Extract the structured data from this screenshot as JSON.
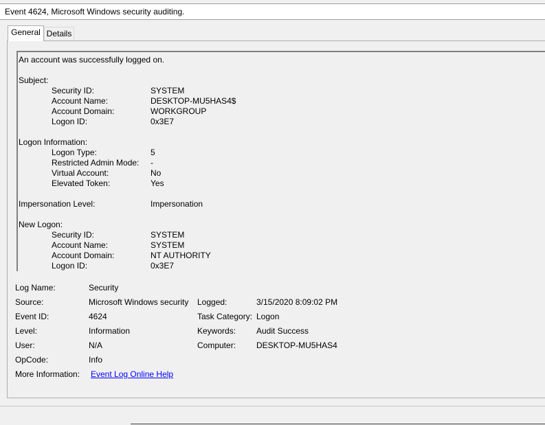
{
  "window": {
    "title": "Event 4624, Microsoft Windows security auditing."
  },
  "tabs": [
    {
      "label": "General"
    },
    {
      "label": "Details"
    }
  ],
  "description": {
    "summary": "An account was successfully logged on.",
    "subject": {
      "heading": "Subject:",
      "rows": [
        {
          "label": "Security ID:",
          "value": "SYSTEM"
        },
        {
          "label": "Account Name:",
          "value": "DESKTOP-MU5HAS4$"
        },
        {
          "label": "Account Domain:",
          "value": "WORKGROUP"
        },
        {
          "label": "Logon ID:",
          "value": "0x3E7"
        }
      ]
    },
    "logon_info": {
      "heading": "Logon Information:",
      "rows": [
        {
          "label": "Logon Type:",
          "value": "5"
        },
        {
          "label": "Restricted Admin Mode:",
          "value": "-"
        },
        {
          "label": "Virtual Account:",
          "value": "No"
        },
        {
          "label": "Elevated Token:",
          "value": "Yes"
        }
      ]
    },
    "impersonation": {
      "label": "Impersonation Level:",
      "value": "Impersonation"
    },
    "new_logon": {
      "heading": "New Logon:",
      "rows": [
        {
          "label": "Security ID:",
          "value": "SYSTEM"
        },
        {
          "label": "Account Name:",
          "value": "SYSTEM"
        },
        {
          "label": "Account Domain:",
          "value": "NT AUTHORITY"
        },
        {
          "label": "Logon ID:",
          "value": "0x3E7"
        }
      ]
    }
  },
  "details": {
    "log_name": {
      "label": "Log Name:",
      "value": "Security"
    },
    "source": {
      "label": "Source:",
      "value": "Microsoft Windows security"
    },
    "logged": {
      "label": "Logged:",
      "value": "3/15/2020 8:09:02 PM"
    },
    "event_id": {
      "label": "Event ID:",
      "value": "4624"
    },
    "task_category": {
      "label": "Task Category:",
      "value": "Logon"
    },
    "level": {
      "label": "Level:",
      "value": "Information"
    },
    "keywords": {
      "label": "Keywords:",
      "value": "Audit Success"
    },
    "user": {
      "label": "User:",
      "value": "N/A"
    },
    "computer": {
      "label": "Computer:",
      "value": "DESKTOP-MU5HAS4"
    },
    "opcode": {
      "label": "OpCode:",
      "value": "Info"
    },
    "more_info": {
      "label": "More Information:",
      "link": "Event Log Online Help"
    }
  }
}
